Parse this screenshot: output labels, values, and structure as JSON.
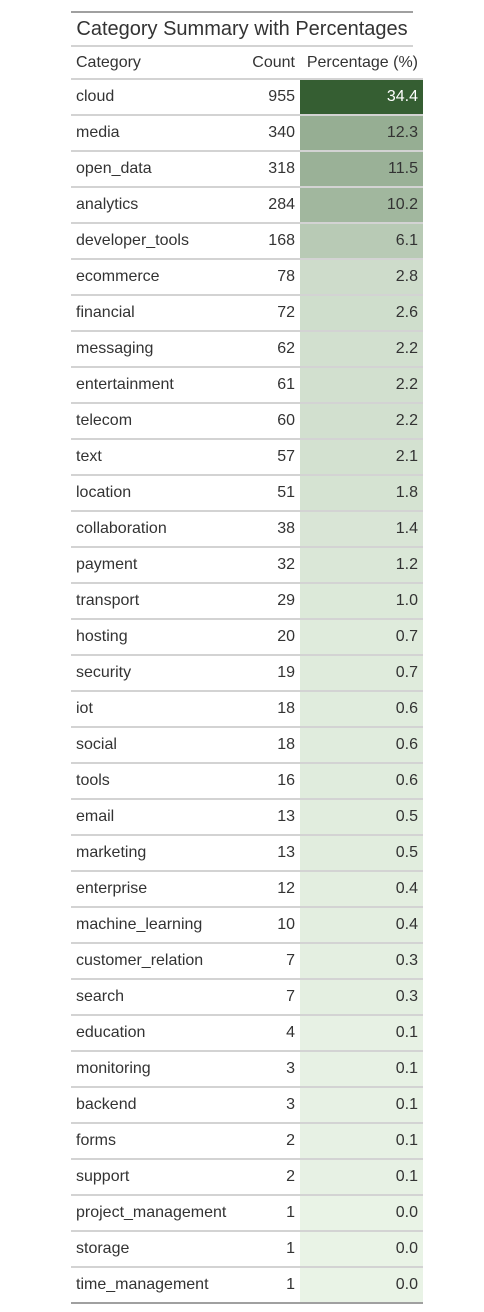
{
  "chart_data": {
    "type": "table",
    "title": "Category Summary with Percentages",
    "columns": [
      "Category",
      "Count",
      "Percentage (%)"
    ],
    "fill_color_low": "#e9f3e6",
    "fill_color_high": "#355e32",
    "text_color_dark": "#333333",
    "text_color_light": "#ffffff",
    "rows": [
      {
        "category": "cloud",
        "count": "955",
        "percentage": "34.4"
      },
      {
        "category": "media",
        "count": "340",
        "percentage": "12.3"
      },
      {
        "category": "open_data",
        "count": "318",
        "percentage": "11.5"
      },
      {
        "category": "analytics",
        "count": "284",
        "percentage": "10.2"
      },
      {
        "category": "developer_tools",
        "count": "168",
        "percentage": "6.1"
      },
      {
        "category": "ecommerce",
        "count": "78",
        "percentage": "2.8"
      },
      {
        "category": "financial",
        "count": "72",
        "percentage": "2.6"
      },
      {
        "category": "messaging",
        "count": "62",
        "percentage": "2.2"
      },
      {
        "category": "entertainment",
        "count": "61",
        "percentage": "2.2"
      },
      {
        "category": "telecom",
        "count": "60",
        "percentage": "2.2"
      },
      {
        "category": "text",
        "count": "57",
        "percentage": "2.1"
      },
      {
        "category": "location",
        "count": "51",
        "percentage": "1.8"
      },
      {
        "category": "collaboration",
        "count": "38",
        "percentage": "1.4"
      },
      {
        "category": "payment",
        "count": "32",
        "percentage": "1.2"
      },
      {
        "category": "transport",
        "count": "29",
        "percentage": "1.0"
      },
      {
        "category": "hosting",
        "count": "20",
        "percentage": "0.7"
      },
      {
        "category": "security",
        "count": "19",
        "percentage": "0.7"
      },
      {
        "category": "iot",
        "count": "18",
        "percentage": "0.6"
      },
      {
        "category": "social",
        "count": "18",
        "percentage": "0.6"
      },
      {
        "category": "tools",
        "count": "16",
        "percentage": "0.6"
      },
      {
        "category": "email",
        "count": "13",
        "percentage": "0.5"
      },
      {
        "category": "marketing",
        "count": "13",
        "percentage": "0.5"
      },
      {
        "category": "enterprise",
        "count": "12",
        "percentage": "0.4"
      },
      {
        "category": "machine_learning",
        "count": "10",
        "percentage": "0.4"
      },
      {
        "category": "customer_relation",
        "count": "7",
        "percentage": "0.3"
      },
      {
        "category": "search",
        "count": "7",
        "percentage": "0.3"
      },
      {
        "category": "education",
        "count": "4",
        "percentage": "0.1"
      },
      {
        "category": "monitoring",
        "count": "3",
        "percentage": "0.1"
      },
      {
        "category": "backend",
        "count": "3",
        "percentage": "0.1"
      },
      {
        "category": "forms",
        "count": "2",
        "percentage": "0.1"
      },
      {
        "category": "support",
        "count": "2",
        "percentage": "0.1"
      },
      {
        "category": "project_management",
        "count": "1",
        "percentage": "0.0"
      },
      {
        "category": "storage",
        "count": "1",
        "percentage": "0.0"
      },
      {
        "category": "time_management",
        "count": "1",
        "percentage": "0.0"
      }
    ]
  }
}
